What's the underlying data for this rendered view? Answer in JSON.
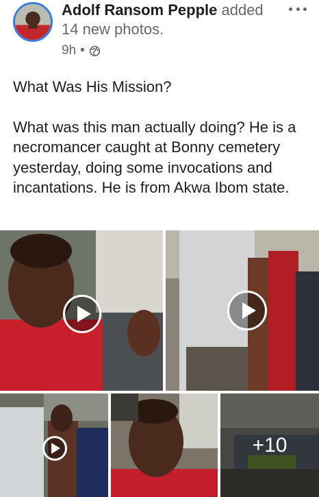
{
  "post": {
    "author": "Adolf Ransom Pepple",
    "action": "added",
    "subtitle": "14 new photos.",
    "time": "9h",
    "separator": "•",
    "privacy_icon": "globe-icon",
    "menu_icon": "more-options-icon"
  },
  "content": {
    "title": "What Was His Mission?",
    "body": "What was this man actually doing? He is a necromancer caught at Bonny cemetery yesterday, doing some invocations and incantations. He is from Akwa Ibom state."
  },
  "media": {
    "tiles": [
      {
        "type": "video",
        "icon": "play-icon"
      },
      {
        "type": "video",
        "icon": "play-icon"
      },
      {
        "type": "video",
        "icon": "play-icon"
      },
      {
        "type": "photo"
      },
      {
        "type": "photo",
        "more_label": "+10"
      }
    ]
  },
  "colors": {
    "avatar_ring": "#3b7ddd",
    "text_primary": "#1c1e21",
    "text_secondary": "#65676b"
  }
}
